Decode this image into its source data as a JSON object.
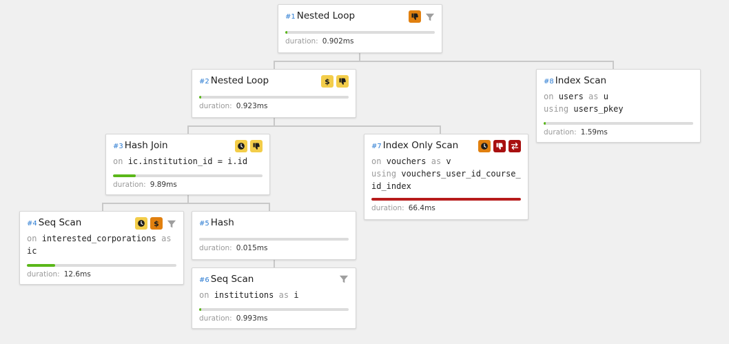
{
  "colors": {
    "green": "#5ab719",
    "red": "#b71c1c",
    "badge_yellow": "#f3cd4a",
    "badge_orange": "#e1800f",
    "badge_red": "#a81010"
  },
  "nodes": [
    {
      "id": "n1",
      "number": "#1",
      "name": "Nested Loop",
      "duration_label": "duration:",
      "duration": "0.902ms",
      "progress": 0.006,
      "bar_color": "green",
      "badges": [
        {
          "type": "thumbs-down",
          "color": "orange"
        }
      ],
      "filter": true
    },
    {
      "id": "n2",
      "number": "#2",
      "name": "Nested Loop",
      "duration_label": "duration:",
      "duration": "0.923ms",
      "progress": 0.006,
      "bar_color": "green",
      "badges": [
        {
          "type": "dollar",
          "color": "yellow"
        },
        {
          "type": "thumbs-down",
          "color": "yellow"
        }
      ],
      "filter": false
    },
    {
      "id": "n3",
      "number": "#3",
      "name": "Hash Join",
      "kw1": "on",
      "cond": "ic.institution_id = i.id",
      "duration_label": "duration:",
      "duration": "9.89ms",
      "progress": 0.15,
      "bar_color": "green",
      "badges": [
        {
          "type": "clock",
          "color": "yellow"
        },
        {
          "type": "thumbs-down",
          "color": "yellow"
        }
      ],
      "filter": false
    },
    {
      "id": "n4",
      "number": "#4",
      "name": "Seq Scan",
      "kw1": "on",
      "relation": "interested_corporations",
      "kw2": "as",
      "alias": "ic",
      "duration_label": "duration:",
      "duration": "12.6ms",
      "progress": 0.19,
      "bar_color": "green",
      "badges": [
        {
          "type": "clock",
          "color": "yellow"
        },
        {
          "type": "dollar",
          "color": "orange"
        }
      ],
      "filter": true
    },
    {
      "id": "n5",
      "number": "#5",
      "name": "Hash",
      "duration_label": "duration:",
      "duration": "0.015ms",
      "progress": 0,
      "bar_color": "green",
      "badges": [],
      "filter": false
    },
    {
      "id": "n6",
      "number": "#6",
      "name": "Seq Scan",
      "kw1": "on",
      "relation": "institutions",
      "kw2": "as",
      "alias": "i",
      "duration_label": "duration:",
      "duration": "0.993ms",
      "progress": 0.006,
      "bar_color": "green",
      "badges": [],
      "filter": true
    },
    {
      "id": "n7",
      "number": "#7",
      "name": "Index Only Scan",
      "kw1": "on",
      "relation": "vouchers",
      "kw2": "as",
      "alias": "v",
      "kw3": "using",
      "index": "vouchers_user_id_course_id_index",
      "duration_label": "duration:",
      "duration": "66.4ms",
      "progress": 1.0,
      "bar_color": "red",
      "badges": [
        {
          "type": "clock",
          "color": "orange"
        },
        {
          "type": "thumbs-down",
          "color": "red"
        },
        {
          "type": "arrows",
          "color": "red"
        }
      ],
      "filter": false
    },
    {
      "id": "n8",
      "number": "#8",
      "name": "Index Scan",
      "kw1": "on",
      "relation": "users",
      "kw2": "as",
      "alias": "u",
      "kw3": "using",
      "index": "users_pkey",
      "duration_label": "duration:",
      "duration": "1.59ms",
      "progress": 0.01,
      "bar_color": "green",
      "badges": [],
      "filter": false
    }
  ]
}
